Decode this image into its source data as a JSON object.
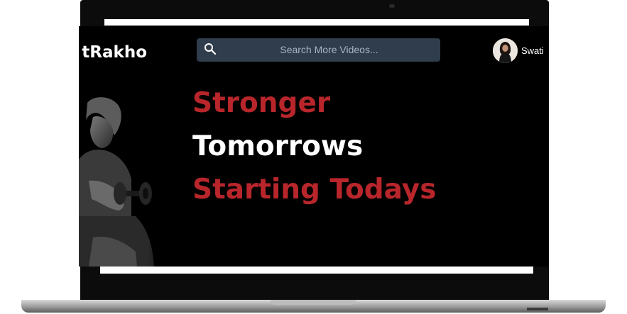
{
  "header": {
    "brand_visible": "tRakho",
    "search_placeholder": "Search More Videos...",
    "user_name": "Swati"
  },
  "hero": {
    "line1": "Stronger",
    "line2": "Tomorrows",
    "line3": "Starting Todays"
  },
  "icons": {
    "search": "search-icon",
    "avatar": "user-avatar"
  },
  "colors": {
    "accent_red": "#b8262b",
    "screen_bg": "#000000",
    "search_bg": "#2f3d4d"
  }
}
